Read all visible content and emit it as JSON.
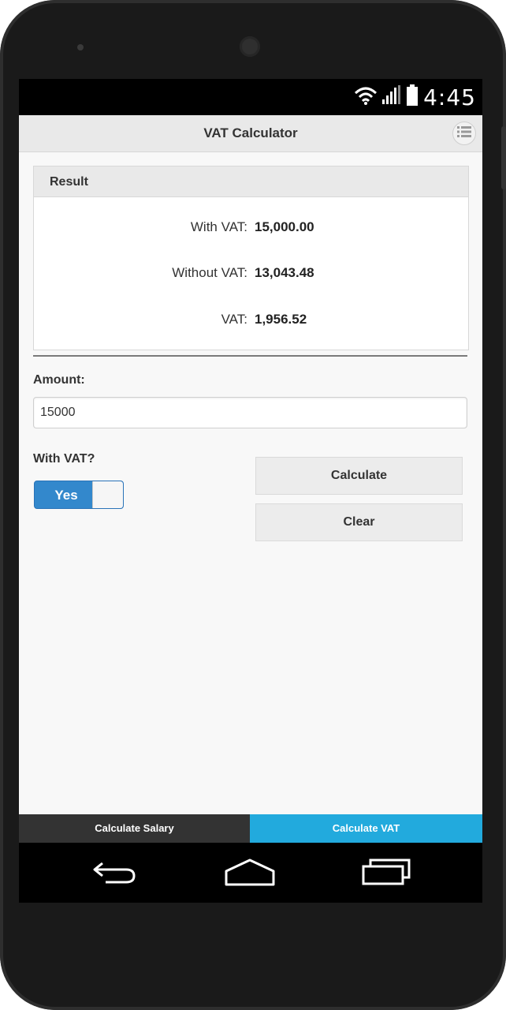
{
  "status_bar": {
    "time": "4:45",
    "icons": [
      "wifi-icon",
      "signal-icon",
      "battery-icon"
    ]
  },
  "header": {
    "title": "VAT Calculator",
    "menu_icon": "list-menu-icon"
  },
  "result": {
    "heading": "Result",
    "rows": [
      {
        "label": "With VAT:",
        "value": "15,000.00"
      },
      {
        "label": "Without VAT:",
        "value": "13,043.48"
      },
      {
        "label": "VAT:",
        "value": "1,956.52"
      }
    ]
  },
  "form": {
    "amount_label": "Amount:",
    "amount_value": "15000",
    "with_vat_label": "With VAT?",
    "toggle_label": "Yes",
    "toggle_state": "on"
  },
  "buttons": {
    "calculate": "Calculate",
    "clear": "Clear"
  },
  "tabs": [
    {
      "label": "Calculate Salary",
      "active": false
    },
    {
      "label": "Calculate VAT",
      "active": true
    }
  ],
  "colors": {
    "accent_blue": "#3388cc",
    "active_tab": "#22aadd",
    "inactive_tab": "#333333"
  },
  "navigation": [
    "back-icon",
    "home-icon",
    "recent-apps-icon"
  ]
}
